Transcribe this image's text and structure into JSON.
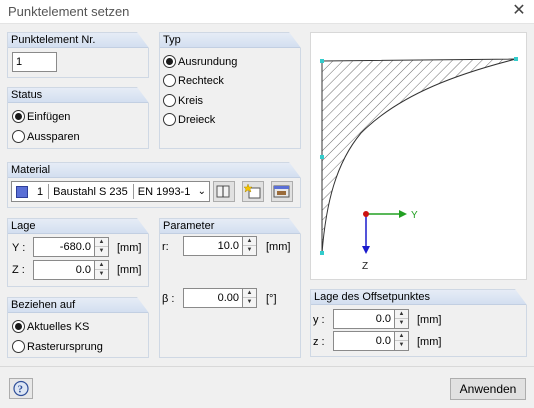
{
  "window": {
    "title": "Punktelement setzen",
    "close_glyph": "✕"
  },
  "element_no": {
    "header": "Punktelement Nr.",
    "value": "1"
  },
  "status": {
    "header": "Status",
    "options": [
      "Einfügen",
      "Aussparen"
    ],
    "selected": "Einfügen"
  },
  "type": {
    "header": "Typ",
    "options": [
      "Ausrundung",
      "Rechteck",
      "Kreis",
      "Dreieck"
    ],
    "selected": "Ausrundung"
  },
  "material": {
    "header": "Material",
    "swatch_color": "#5a6fd6",
    "number": "1",
    "name": "Baustahl S 235",
    "standard": "EN 1993-1-",
    "icons": [
      "library-icon",
      "new-material-icon",
      "edit-material-icon"
    ]
  },
  "position": {
    "header": "Lage",
    "y_label": "Y :",
    "y_value": "-680.0",
    "y_unit": "[mm]",
    "z_label": "Z :",
    "z_value": "0.0",
    "z_unit": "[mm]"
  },
  "parameter": {
    "header": "Parameter",
    "r_label": "r:",
    "r_value": "10.0",
    "r_unit": "[mm]",
    "beta_label": "β :",
    "beta_value": "0.00",
    "beta_unit": "[°]"
  },
  "reference": {
    "header": "Beziehen auf",
    "options": [
      "Aktuelles KS",
      "Rasterursprung"
    ],
    "selected": "Aktuelles KS"
  },
  "offset": {
    "header": "Lage des Offsetpunktes",
    "y_label": "y :",
    "y_value": "0.0",
    "y_unit": "[mm]",
    "z_label": "z :",
    "z_value": "0.0",
    "z_unit": "[mm]"
  },
  "preview": {
    "axis_y": "Y",
    "axis_z": "Z"
  },
  "footer": {
    "apply_label": "Anwenden"
  },
  "colors": {
    "accent": "#0078d7",
    "axis_y": "#22a022",
    "axis_z": "#1a1acc",
    "origin": "#cc1111",
    "point": "#33cccc"
  }
}
